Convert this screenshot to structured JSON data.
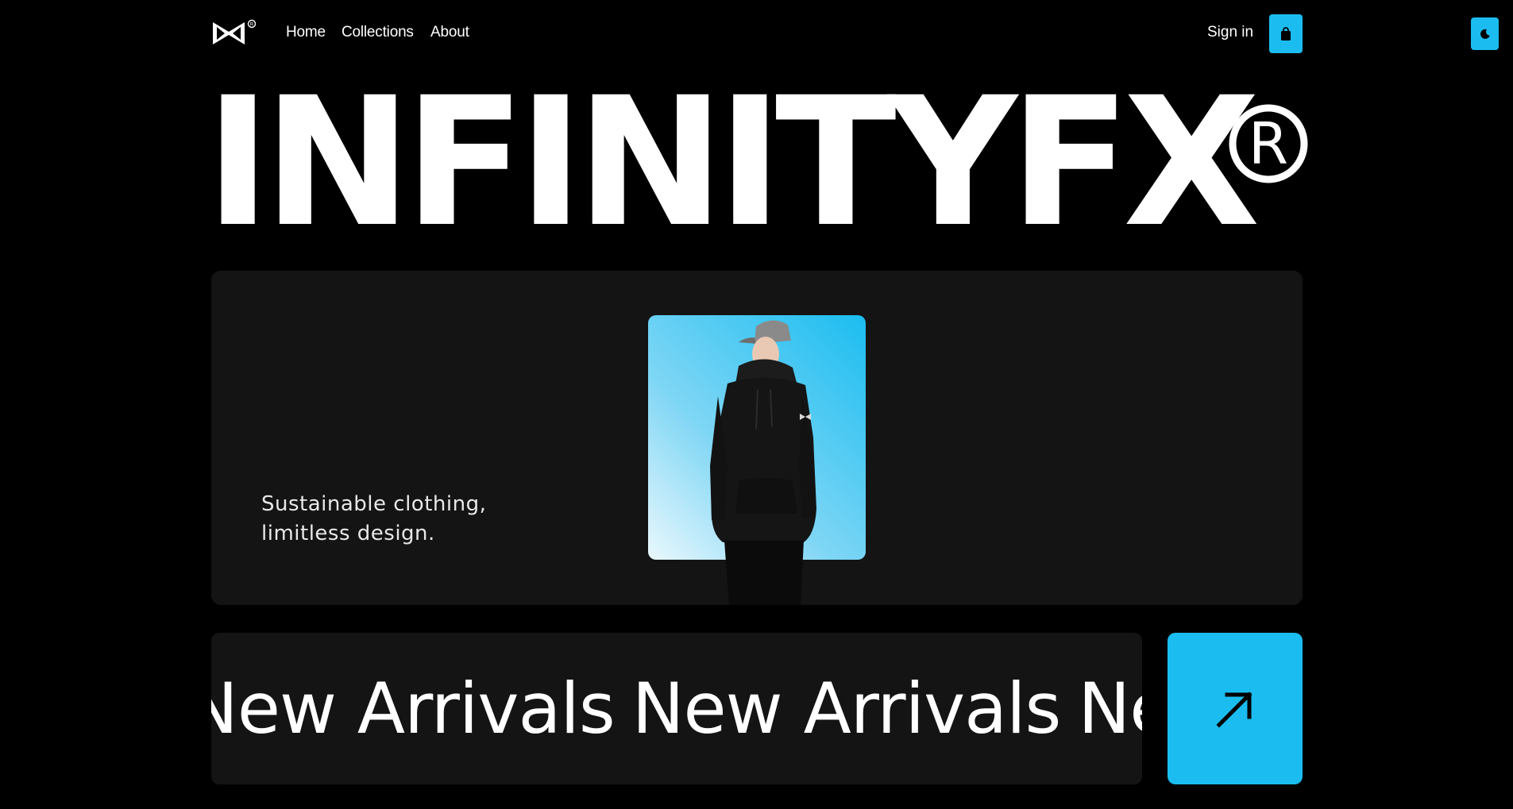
{
  "brand": {
    "logo_icon": "infinityfx-bowtie-logo-icon",
    "name": "INFINITYFX",
    "registered_mark": "®"
  },
  "nav": {
    "links": [
      "Home",
      "Collections",
      "About"
    ],
    "signin_label": "Sign in",
    "cart_icon": "shopping-bag-icon",
    "theme_icon": "moon-icon"
  },
  "hero": {
    "tagline": "Sustainable clothing, limitless design.",
    "image": "model-wearing-black-hoodie-and-cap"
  },
  "marquee": {
    "text": [
      "New Arrivals",
      "New Arrivals",
      "New Arr"
    ],
    "arrow_icon": "arrow-up-right-icon"
  },
  "colors": {
    "accent": "#1bbdf0",
    "background": "#000000",
    "card": "#141414",
    "text": "#ffffff"
  }
}
